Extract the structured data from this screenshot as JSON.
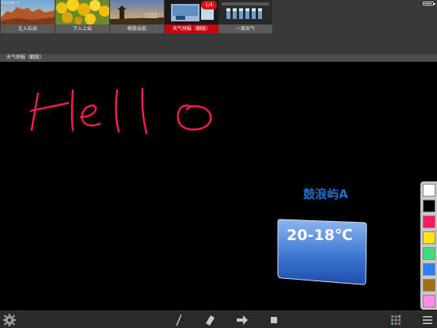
{
  "status_bar": {
    "carrier": "Carrier ✈"
  },
  "thumbnails": [
    {
      "label": "左入右出",
      "icon": "desert-rocks-thumbnail"
    },
    {
      "label": "下入上出",
      "icon": "yellow-tulips-thumbnail"
    },
    {
      "label": "缩放出现",
      "icon": "pagoda-sunset-thumbnail"
    },
    {
      "label": "天气预报（翻版）",
      "icon": "weather-slide-thumbnail",
      "active": true,
      "badge": "1/4"
    },
    {
      "label": "一周天气",
      "icon": "week-weather-thumbnail"
    }
  ],
  "slide": {
    "title": "天气预报（翻版）"
  },
  "canvas": {
    "handwriting": "Hello",
    "location": "鼓浪屿A",
    "temperature": "20-18℃"
  },
  "palette": {
    "colors": [
      "#ffffff",
      "#000000",
      "#ff1a5a",
      "#ffe01a",
      "#33e07a",
      "#2f7dff",
      "#a0700f",
      "#ff8ce8"
    ]
  },
  "toolbar": {
    "items": [
      "settings-icon",
      "pen-icon",
      "eraser-icon",
      "next-arrow-icon",
      "stop-icon",
      "grid-view-icon",
      "menu-icon"
    ]
  },
  "colors": {
    "accent_red": "#c8050b",
    "ink_pink": "#ff1a5a",
    "location_blue": "#1d6fd6",
    "card_blue": "#2f67d0"
  }
}
